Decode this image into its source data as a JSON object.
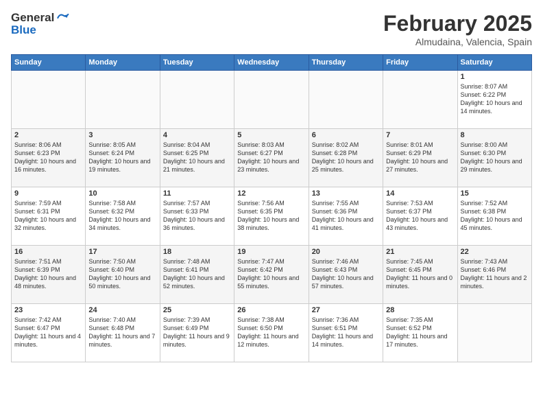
{
  "logo": {
    "general": "General",
    "blue": "Blue"
  },
  "title": {
    "month_year": "February 2025",
    "location": "Almudaina, Valencia, Spain"
  },
  "headers": [
    "Sunday",
    "Monday",
    "Tuesday",
    "Wednesday",
    "Thursday",
    "Friday",
    "Saturday"
  ],
  "weeks": [
    [
      {
        "num": "",
        "info": ""
      },
      {
        "num": "",
        "info": ""
      },
      {
        "num": "",
        "info": ""
      },
      {
        "num": "",
        "info": ""
      },
      {
        "num": "",
        "info": ""
      },
      {
        "num": "",
        "info": ""
      },
      {
        "num": "1",
        "info": "Sunrise: 8:07 AM\nSunset: 6:22 PM\nDaylight: 10 hours and 14 minutes."
      }
    ],
    [
      {
        "num": "2",
        "info": "Sunrise: 8:06 AM\nSunset: 6:23 PM\nDaylight: 10 hours and 16 minutes."
      },
      {
        "num": "3",
        "info": "Sunrise: 8:05 AM\nSunset: 6:24 PM\nDaylight: 10 hours and 19 minutes."
      },
      {
        "num": "4",
        "info": "Sunrise: 8:04 AM\nSunset: 6:25 PM\nDaylight: 10 hours and 21 minutes."
      },
      {
        "num": "5",
        "info": "Sunrise: 8:03 AM\nSunset: 6:27 PM\nDaylight: 10 hours and 23 minutes."
      },
      {
        "num": "6",
        "info": "Sunrise: 8:02 AM\nSunset: 6:28 PM\nDaylight: 10 hours and 25 minutes."
      },
      {
        "num": "7",
        "info": "Sunrise: 8:01 AM\nSunset: 6:29 PM\nDaylight: 10 hours and 27 minutes."
      },
      {
        "num": "8",
        "info": "Sunrise: 8:00 AM\nSunset: 6:30 PM\nDaylight: 10 hours and 29 minutes."
      }
    ],
    [
      {
        "num": "9",
        "info": "Sunrise: 7:59 AM\nSunset: 6:31 PM\nDaylight: 10 hours and 32 minutes."
      },
      {
        "num": "10",
        "info": "Sunrise: 7:58 AM\nSunset: 6:32 PM\nDaylight: 10 hours and 34 minutes."
      },
      {
        "num": "11",
        "info": "Sunrise: 7:57 AM\nSunset: 6:33 PM\nDaylight: 10 hours and 36 minutes."
      },
      {
        "num": "12",
        "info": "Sunrise: 7:56 AM\nSunset: 6:35 PM\nDaylight: 10 hours and 38 minutes."
      },
      {
        "num": "13",
        "info": "Sunrise: 7:55 AM\nSunset: 6:36 PM\nDaylight: 10 hours and 41 minutes."
      },
      {
        "num": "14",
        "info": "Sunrise: 7:53 AM\nSunset: 6:37 PM\nDaylight: 10 hours and 43 minutes."
      },
      {
        "num": "15",
        "info": "Sunrise: 7:52 AM\nSunset: 6:38 PM\nDaylight: 10 hours and 45 minutes."
      }
    ],
    [
      {
        "num": "16",
        "info": "Sunrise: 7:51 AM\nSunset: 6:39 PM\nDaylight: 10 hours and 48 minutes."
      },
      {
        "num": "17",
        "info": "Sunrise: 7:50 AM\nSunset: 6:40 PM\nDaylight: 10 hours and 50 minutes."
      },
      {
        "num": "18",
        "info": "Sunrise: 7:48 AM\nSunset: 6:41 PM\nDaylight: 10 hours and 52 minutes."
      },
      {
        "num": "19",
        "info": "Sunrise: 7:47 AM\nSunset: 6:42 PM\nDaylight: 10 hours and 55 minutes."
      },
      {
        "num": "20",
        "info": "Sunrise: 7:46 AM\nSunset: 6:43 PM\nDaylight: 10 hours and 57 minutes."
      },
      {
        "num": "21",
        "info": "Sunrise: 7:45 AM\nSunset: 6:45 PM\nDaylight: 11 hours and 0 minutes."
      },
      {
        "num": "22",
        "info": "Sunrise: 7:43 AM\nSunset: 6:46 PM\nDaylight: 11 hours and 2 minutes."
      }
    ],
    [
      {
        "num": "23",
        "info": "Sunrise: 7:42 AM\nSunset: 6:47 PM\nDaylight: 11 hours and 4 minutes."
      },
      {
        "num": "24",
        "info": "Sunrise: 7:40 AM\nSunset: 6:48 PM\nDaylight: 11 hours and 7 minutes."
      },
      {
        "num": "25",
        "info": "Sunrise: 7:39 AM\nSunset: 6:49 PM\nDaylight: 11 hours and 9 minutes."
      },
      {
        "num": "26",
        "info": "Sunrise: 7:38 AM\nSunset: 6:50 PM\nDaylight: 11 hours and 12 minutes."
      },
      {
        "num": "27",
        "info": "Sunrise: 7:36 AM\nSunset: 6:51 PM\nDaylight: 11 hours and 14 minutes."
      },
      {
        "num": "28",
        "info": "Sunrise: 7:35 AM\nSunset: 6:52 PM\nDaylight: 11 hours and 17 minutes."
      },
      {
        "num": "",
        "info": ""
      }
    ]
  ]
}
